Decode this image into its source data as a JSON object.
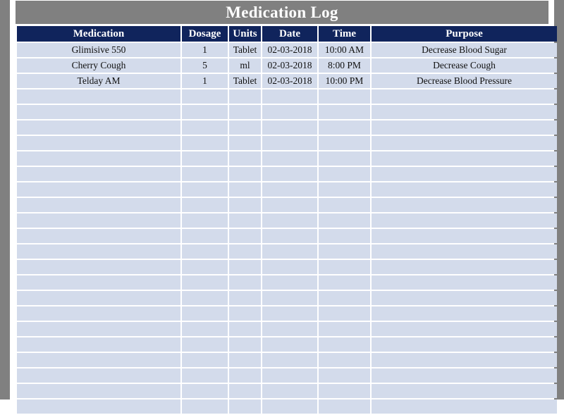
{
  "document": {
    "title": "Medication Log"
  },
  "table": {
    "columns": [
      {
        "key": "medication",
        "label": "Medication"
      },
      {
        "key": "dosage",
        "label": "Dosage"
      },
      {
        "key": "units",
        "label": "Units"
      },
      {
        "key": "date",
        "label": "Date"
      },
      {
        "key": "time",
        "label": "Time"
      },
      {
        "key": "purpose",
        "label": "Purpose"
      }
    ],
    "rows": [
      {
        "medication": "Glimisive 550",
        "dosage": "1",
        "units": "Tablet",
        "date": "02-03-2018",
        "time": "10:00 AM",
        "purpose": "Decrease Blood Sugar"
      },
      {
        "medication": "Cherry Cough",
        "dosage": "5",
        "units": "ml",
        "date": "02-03-2018",
        "time": "8:00 PM",
        "purpose": "Decrease Cough"
      },
      {
        "medication": "Telday AM",
        "dosage": "1",
        "units": "Tablet",
        "date": "02-03-2018",
        "time": "10:00 PM",
        "purpose": "Decrease Blood Pressure"
      }
    ],
    "empty_row_count": 21
  },
  "colors": {
    "frame_gray": "#808080",
    "header_navy": "#10245c",
    "cell_fill": "#d3dbeb",
    "gridline": "#ffffff",
    "title_text": "#ffffff",
    "body_text": "#101010"
  }
}
